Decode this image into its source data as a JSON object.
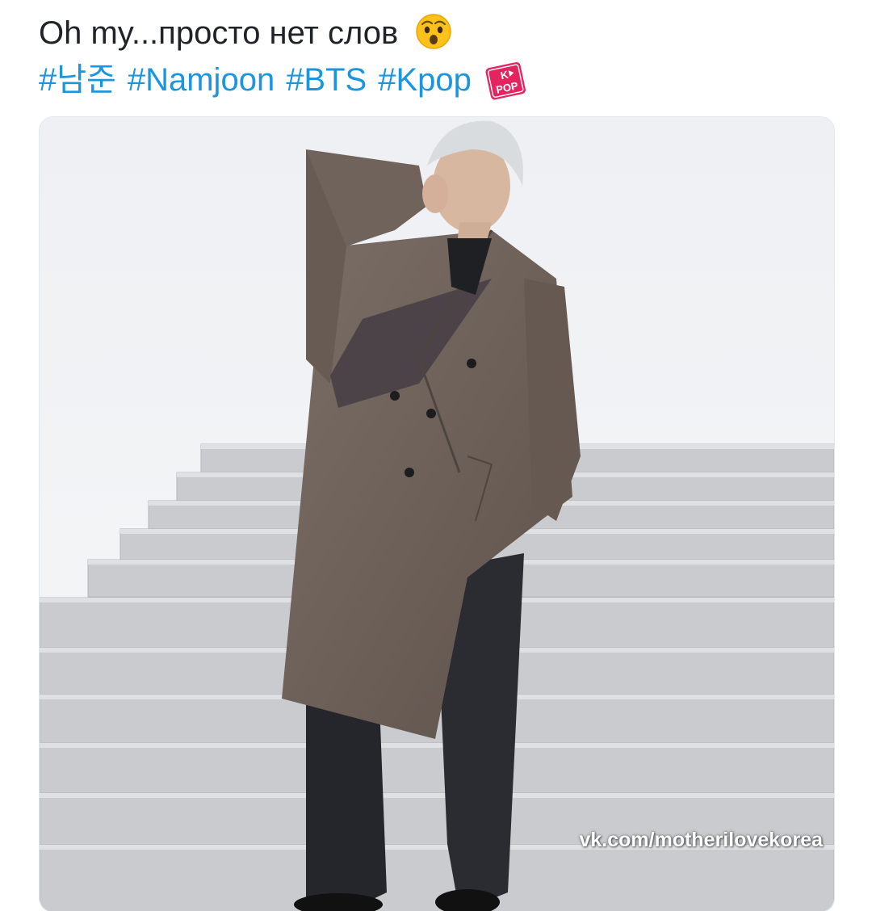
{
  "post": {
    "text": "Oh my...просто нет слов",
    "emoji": "astonished-face-emoji",
    "hashtags": [
      "#남준",
      "#Namjoon",
      "#BTS",
      "#Kpop"
    ],
    "badge": "K-POP",
    "badge_text": "POP",
    "badge_letter": "K"
  },
  "media": {
    "description_icon": "photo",
    "watermark": "vk.com/motherilovekorea"
  },
  "colors": {
    "hashtag": "#1b95e0",
    "text": "#1f2328",
    "badge": "#e4245f"
  }
}
